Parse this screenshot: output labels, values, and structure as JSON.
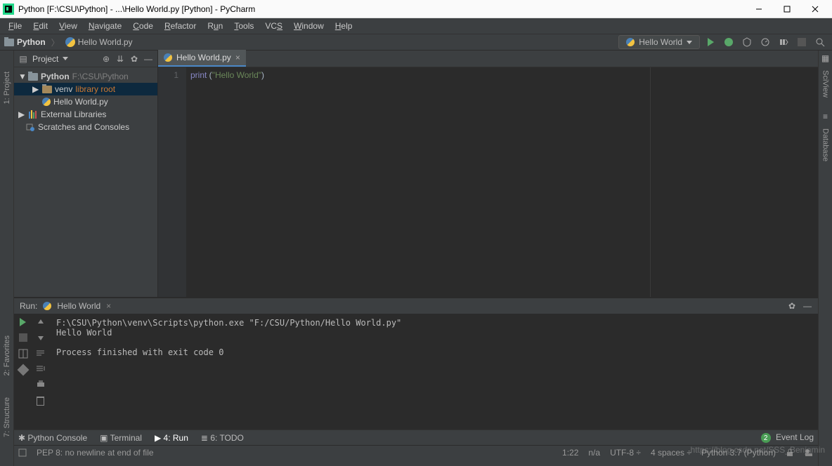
{
  "window": {
    "title": "Python [F:\\CSU\\Python] - ...\\Hello World.py [Python] - PyCharm"
  },
  "menu": [
    "File",
    "Edit",
    "View",
    "Navigate",
    "Code",
    "Refactor",
    "Run",
    "Tools",
    "VCS",
    "Window",
    "Help"
  ],
  "breadcrumb": {
    "root": "Python",
    "file": "Hello World.py"
  },
  "run_config": {
    "selected": "Hello World"
  },
  "project_panel": {
    "title": "Project",
    "root": {
      "name": "Python",
      "path": "F:\\CSU\\Python"
    },
    "venv": {
      "name": "venv",
      "hint": "library root"
    },
    "file": "Hello World.py",
    "external": "External Libraries",
    "scratches": "Scratches and Consoles"
  },
  "editor": {
    "tab": "Hello World.py",
    "lineno": "1",
    "code_kw": "print",
    "code_paren1": " (",
    "code_str": "\"Hello World\"",
    "code_paren2": ")"
  },
  "run_panel": {
    "label": "Run:",
    "title": "Hello World",
    "output": "F:\\CSU\\Python\\venv\\Scripts\\python.exe \"F:/CSU/Python/Hello World.py\"\nHello World\n\nProcess finished with exit code 0"
  },
  "bottom": {
    "python_console": "Python Console",
    "terminal": "Terminal",
    "run": "4: Run",
    "todo": "6: TODO",
    "event_log": "Event Log",
    "event_count": "2"
  },
  "status": {
    "message": "PEP 8: no newline at end of file",
    "pos": "1:22",
    "na": "n/a",
    "encoding": "UTF-8",
    "indent": "4 spaces",
    "sdk": "Python 3.7 (Python)"
  },
  "watermark": "https://blog.csdn.net/SSS_Benjamin",
  "sidebars": {
    "project_tab": "1: Project",
    "favorites": "2: Favorites",
    "structure": "7: Structure",
    "sciview": "SciView",
    "database": "Database"
  }
}
